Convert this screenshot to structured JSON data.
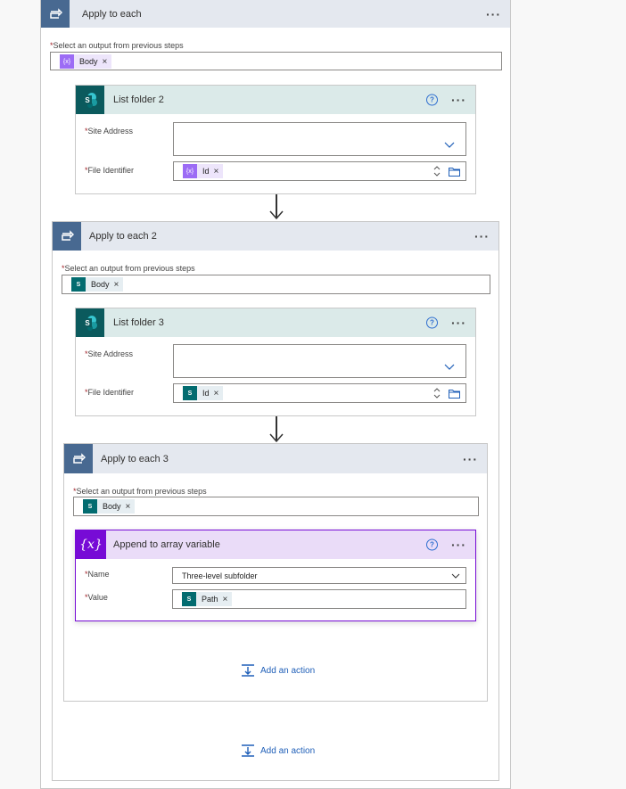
{
  "outer_loop": {
    "title": "Apply to each",
    "select_label": "Select an output from previous steps",
    "token": "Body",
    "token_remove": "×"
  },
  "list_folder_2": {
    "title": "List folder 2",
    "site_label": "Site Address",
    "file_label": "File Identifier",
    "file_token": "Id",
    "token_remove": "×"
  },
  "loop2": {
    "title": "Apply to each 2",
    "select_label": "Select an output from previous steps",
    "token": "Body",
    "token_remove": "×"
  },
  "list_folder_3": {
    "title": "List folder 3",
    "site_label": "Site Address",
    "file_label": "File Identifier",
    "file_token": "Id",
    "token_remove": "×"
  },
  "loop3": {
    "title": "Apply to each 3",
    "select_label": "Select an output from previous steps",
    "token": "Body",
    "token_remove": "×"
  },
  "append": {
    "title": "Append to array variable",
    "name_label": "Name",
    "name_value": "Three-level subfolder",
    "value_label": "Value",
    "value_token": "Path",
    "token_remove": "×"
  },
  "common": {
    "required_mark": "*",
    "more": "···",
    "help": "?",
    "sp_letter": "S",
    "var_glyph": "{x}",
    "tok_var_glyph": "{x}",
    "tok_sp_glyph": "S"
  },
  "add_action_inner": "Add an action",
  "add_action_outer": "Add an action",
  "colors": {
    "loop_accent": "#486991",
    "sharepoint": "#036c70",
    "variable": "#770bd6",
    "link": "#1f5fb8"
  }
}
